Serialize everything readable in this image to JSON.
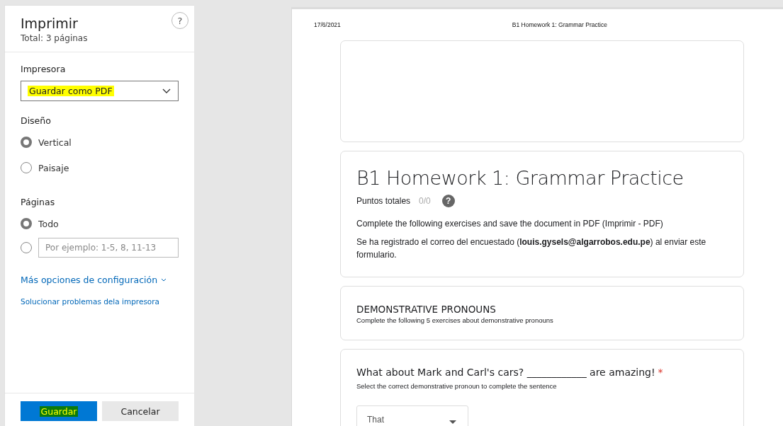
{
  "print_panel": {
    "title": "Imprimir",
    "subtitle": "Total: 3 páginas",
    "help": "?",
    "printer": {
      "label": "Impresora",
      "value": "Guardar como PDF",
      "color": "#ffff00"
    },
    "layout": {
      "label": "Diseño",
      "options": [
        {
          "label": "Vertical",
          "selected": true
        },
        {
          "label": "Paisaje",
          "selected": false
        }
      ]
    },
    "pages": {
      "label": "Páginas",
      "options": [
        {
          "kind": "label",
          "label": "Todo",
          "selected": true
        },
        {
          "kind": "field",
          "placeholder": "Por ejemplo: 1-5, 8, 11-13",
          "selected": false
        }
      ]
    },
    "more_link": "Más opciones de configuración",
    "help_link": "Solucionar problemas dela impresora",
    "buttons": [
      {
        "kind": "primary",
        "label": "Guardar",
        "color": "#0b7a0b"
      },
      {
        "kind": "secondary",
        "label": "Cancelar"
      }
    ]
  },
  "preview": {
    "header_date": "17/6/2021",
    "header_title": "B1 Homework 1: Grammar Practice",
    "form_title": "B1 Homework 1: Grammar Practice",
    "points_label": "Puntos totales",
    "points_value": "0/0",
    "points_help": "?",
    "description": "Complete the following exercises and save the document in PDF (Imprimir - PDF)",
    "email_note": "Se ha registrado el correo del encuestado (**louis.gysels@algarrobos.edu.pe**) al enviar este formulario.",
    "section": {
      "title": "DEMONSTRATIVE PRONOUNS",
      "description": "Complete the following 5 exercises about demonstrative pronouns"
    },
    "question": {
      "text": "What about Mark and Carl's cars? ____________ are amazing!",
      "required_mark": "*",
      "hint": "Select the correct demonstrative pronoun to complete the sentence",
      "answer": "That"
    }
  }
}
